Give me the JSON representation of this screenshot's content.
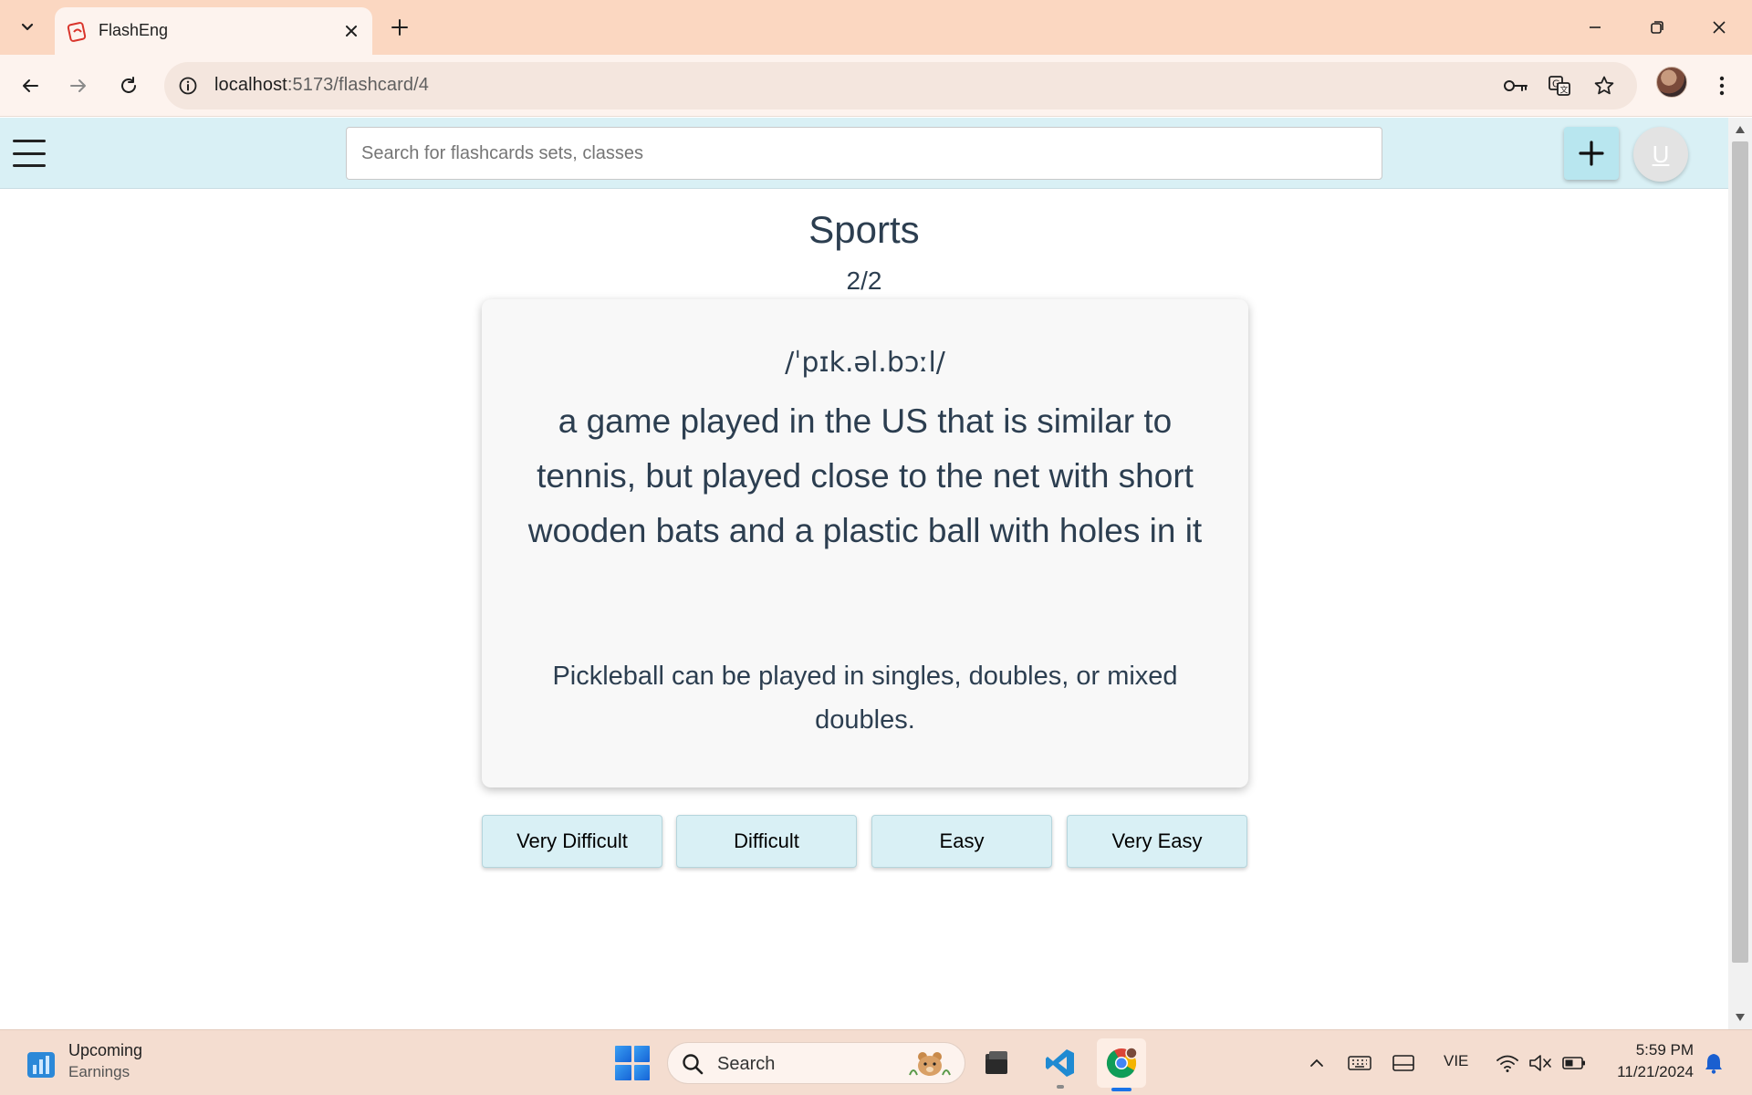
{
  "browser": {
    "tab_title": "FlashEng",
    "url_host": "localhost",
    "url_rest": ":5173/flashcard/4"
  },
  "app": {
    "search_placeholder": "Search for flashcards sets, classes",
    "add_icon": "plus-icon",
    "avatar_letter": "U"
  },
  "flashcard": {
    "set_title": "Sports",
    "progress": "2/2",
    "phonetic": "/ˈpɪk.əl.bɔːl/",
    "definition": "a game played in the US that is similar to tennis, but played close to the net with short wooden bats and a plastic ball with holes in it",
    "example": "Pickleball can be played in singles, doubles, or mixed doubles."
  },
  "rating_buttons": [
    "Very Difficult",
    "Difficult",
    "Easy",
    "Very Easy"
  ],
  "taskbar": {
    "widget_title": "Upcoming",
    "widget_sub": "Earnings",
    "search_label": "Search",
    "language": "VIE",
    "time": "5:59 PM",
    "date": "11/21/2024"
  },
  "colors": {
    "header_bg": "#d9f0f5",
    "accent_button": "#b8e6ef",
    "tabbar_bg": "#fbd7c1",
    "text_primary": "#2c3e50"
  }
}
